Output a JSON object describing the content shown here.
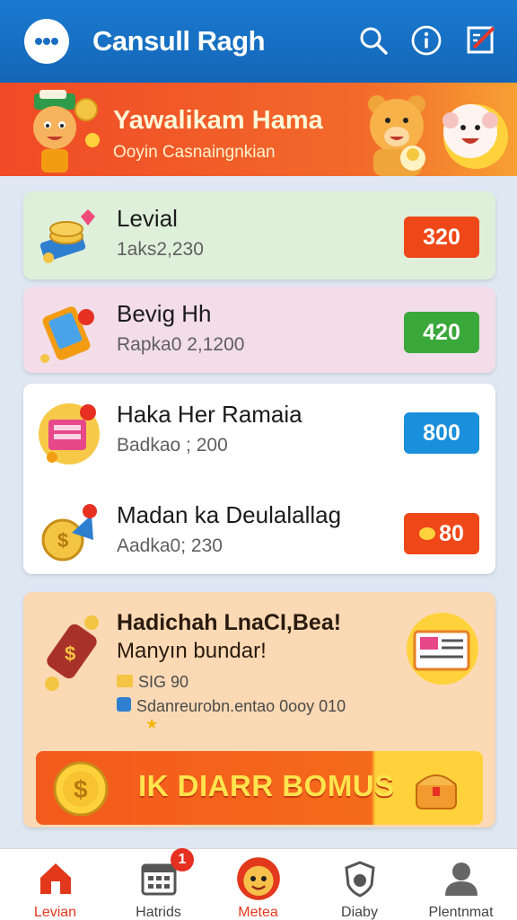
{
  "app": {
    "title": "Cansull Ragh"
  },
  "header": {
    "icons": [
      "search-icon",
      "info-icon",
      "edit-icon"
    ]
  },
  "banner": {
    "title": "Yawalikam Hama",
    "subtitle": "Ooyin Casnaingnkian"
  },
  "rows": [
    {
      "title": "Levial",
      "subtitle": "1aks2,230",
      "value": "320",
      "color": "#ef4818",
      "bg": "#dff0da",
      "icon": "coins-icon"
    },
    {
      "title": "Bevig Hh",
      "subtitle": "Rapka0 2,1200",
      "value": "420",
      "color": "#3aa83a",
      "bg": "#f2dde9",
      "icon": "calculator-icon"
    },
    {
      "title": "Haka Her Ramaia",
      "subtitle": "Badkao ; 200",
      "value": "800",
      "color": "#1a8fdb",
      "bg": "#ffffff",
      "icon": "gift-box-icon"
    },
    {
      "title": "Madan ka Deulalallag",
      "subtitle": "Aadka0; 230",
      "value": "80",
      "color": "#ef4818",
      "bg": "#ffffff",
      "icon": "coin-arrow-icon"
    }
  ],
  "promo": {
    "title": "Hadichah LnaCI,Bea!",
    "subtitle": "Manyın bundar!",
    "line1": "SIG 90",
    "line2": "Sdanreurobn.entao 0ooy 010",
    "bonus_label": "IK DIARR BOMUS"
  },
  "tabs": [
    {
      "label": "Levian",
      "icon": "home-icon",
      "active": true
    },
    {
      "label": "Hatrids",
      "icon": "calendar-icon",
      "active": false,
      "badge": "1"
    },
    {
      "label": "Metea",
      "icon": "mascot-icon",
      "active": false
    },
    {
      "label": "Diaby",
      "icon": "shield-icon",
      "active": false
    },
    {
      "label": "Plentnmat",
      "icon": "profile-icon",
      "active": false
    }
  ],
  "colors": {
    "appbar": "#1a7ad0",
    "banner": "#f04a26",
    "accent_red": "#ef4818",
    "accent_green": "#3aa83a",
    "accent_blue": "#1a8fdb"
  }
}
